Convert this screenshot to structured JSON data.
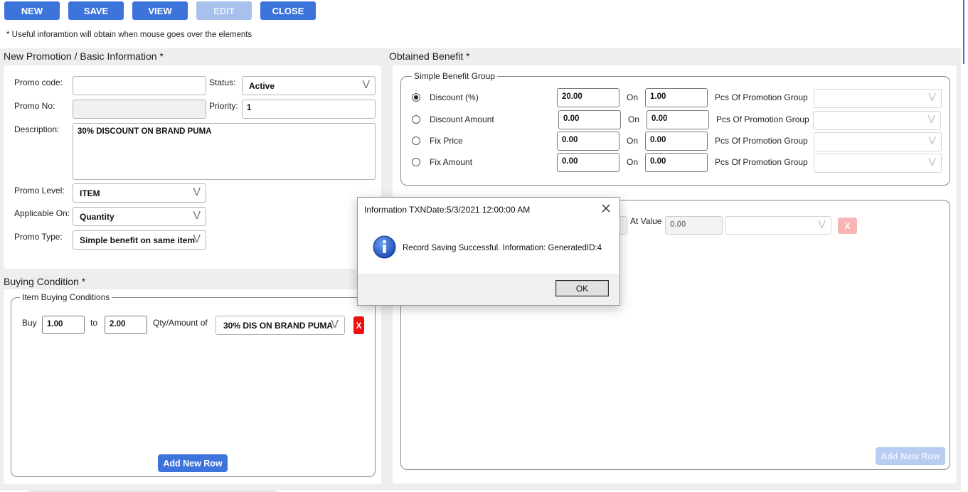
{
  "toolbar": {
    "new": "NEW",
    "save": "SAVE",
    "view": "VIEW",
    "edit": "EDIT",
    "close": "CLOSE"
  },
  "hint": "* Useful inforamtion will obtain when mouse goes over the elements",
  "basic": {
    "title": "New Promotion / Basic Information *",
    "promo_code_label": "Promo code:",
    "promo_code_value": "",
    "status_label": "Status:",
    "status_value": "Active",
    "promo_no_label": "Promo No:",
    "promo_no_value": "",
    "priority_label": "Priority:",
    "priority_value": "1",
    "description_label": "Description:",
    "description_value": "30% DISCOUNT ON BRAND PUMA",
    "promo_level_label": "Promo Level:",
    "promo_level_value": "ITEM",
    "applicable_on_label": "Applicable On:",
    "applicable_on_value": "Quantity",
    "promo_type_label": "Promo Type:",
    "promo_type_value": "Simple benefit on same item"
  },
  "buying": {
    "title": "Buying Condition *",
    "group_label": "Item Buying Conditions",
    "buy_label": "Buy",
    "buy_value": "1.00",
    "to_label": "to",
    "to_value": "2.00",
    "qty_label": "Qty/Amount of",
    "item_value": "30% DIS ON BRAND PUMA",
    "remove_label": "X",
    "add_row": "Add New Row"
  },
  "benefit": {
    "title": "Obtained Benefit *",
    "group_label": "Simple Benefit Group",
    "on_label": "On",
    "pcs_label": "Pcs Of Promotion Group",
    "rows": [
      {
        "label": "Discount (%)",
        "value": "20.00",
        "on_value": "1.00",
        "checked": true
      },
      {
        "label": "Discount Amount",
        "value": "0.00",
        "on_value": "0.00",
        "checked": false
      },
      {
        "label": "Fix Price",
        "value": "0.00",
        "on_value": "0.00",
        "checked": false
      },
      {
        "label": "Fix Amount",
        "value": "0.00",
        "on_value": "0.00",
        "checked": false
      }
    ],
    "at_value_label": "At Value",
    "at_value": "0.00",
    "remove_label": "X",
    "add_row": "Add New Row"
  },
  "dialog": {
    "title": "Information TXNDate:5/3/2021 12:00:00 AM",
    "message": "Record Saving Successful. Information: GeneratedID:4",
    "ok": "OK"
  },
  "colors": {
    "primary": "#3c74dc",
    "danger": "#f20c0c",
    "info_icon": "#1f4fb4"
  }
}
